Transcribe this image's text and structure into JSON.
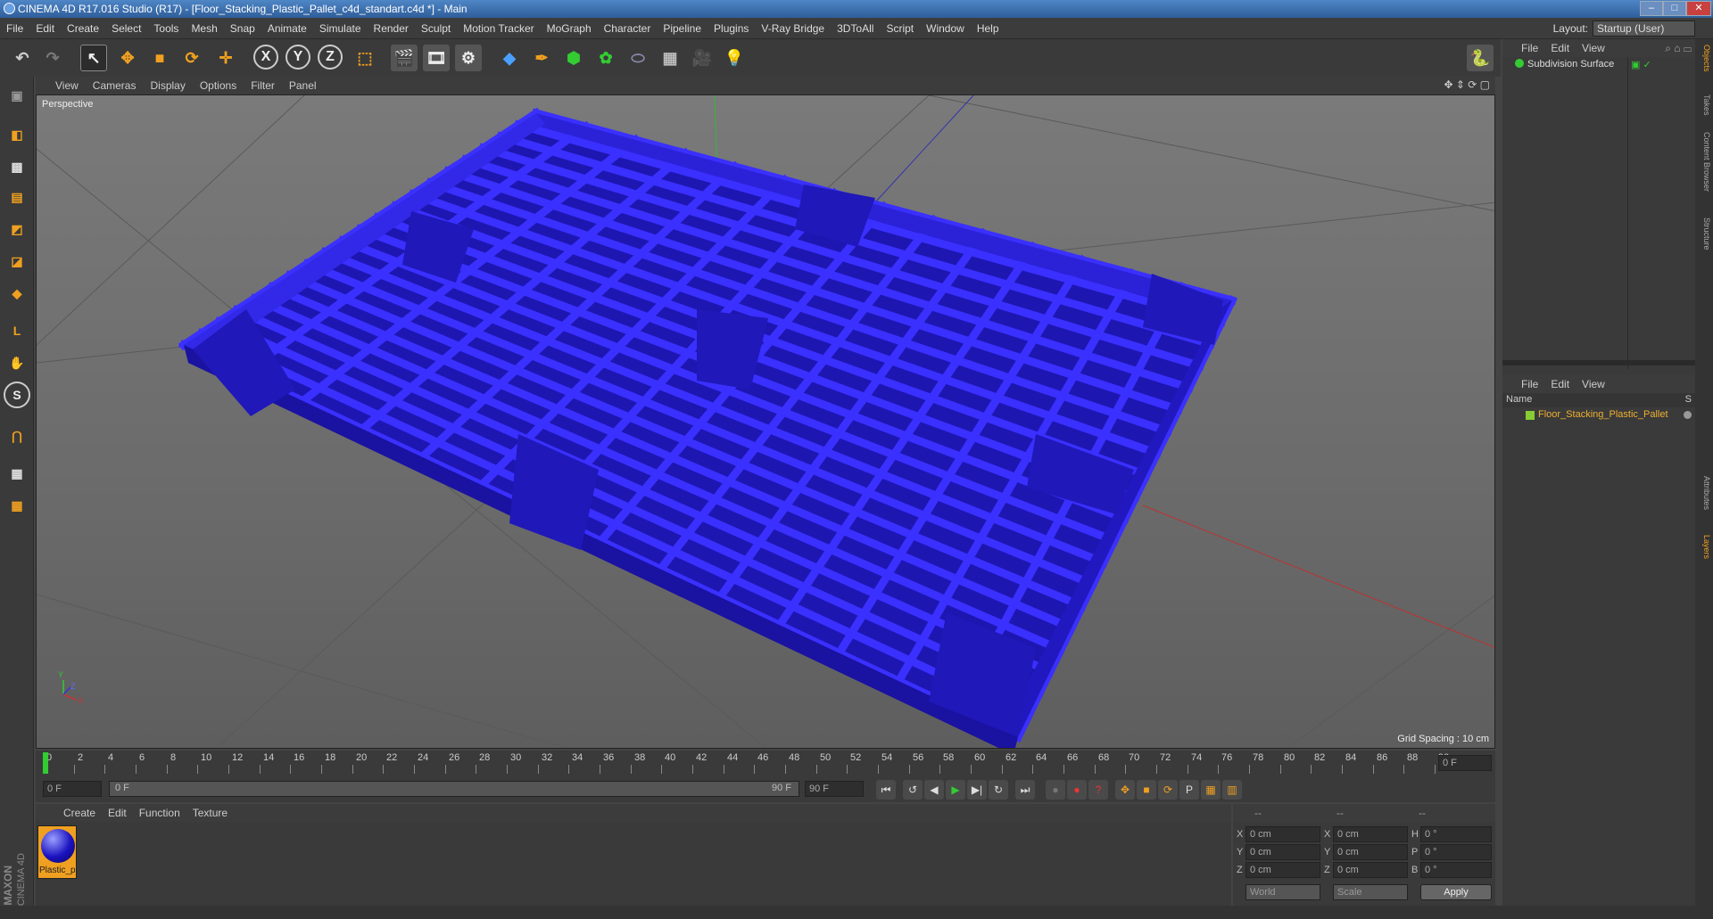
{
  "window": {
    "title": "CINEMA 4D R17.016 Studio (R17) - [Floor_Stacking_Plastic_Pallet_c4d_standart.c4d *] - Main"
  },
  "menu": [
    "File",
    "Edit",
    "Create",
    "Select",
    "Tools",
    "Mesh",
    "Snap",
    "Animate",
    "Simulate",
    "Render",
    "Sculpt",
    "Motion Tracker",
    "MoGraph",
    "Character",
    "Pipeline",
    "Plugins",
    "V-Ray Bridge",
    "3DToAll",
    "Script",
    "Window",
    "Help"
  ],
  "layout": {
    "label": "Layout:",
    "value": "Startup (User)"
  },
  "viewport": {
    "menu": [
      "View",
      "Cameras",
      "Display",
      "Options",
      "Filter",
      "Panel"
    ],
    "label": "Perspective",
    "grid_spacing": "Grid Spacing : 10 cm",
    "axis": {
      "x": "X",
      "y": "Y",
      "z": "Z"
    }
  },
  "timeline": {
    "ticks": [
      "0",
      "2",
      "4",
      "6",
      "8",
      "10",
      "12",
      "14",
      "16",
      "18",
      "20",
      "22",
      "24",
      "26",
      "28",
      "30",
      "32",
      "34",
      "36",
      "38",
      "40",
      "42",
      "44",
      "46",
      "48",
      "50",
      "52",
      "54",
      "56",
      "58",
      "60",
      "62",
      "64",
      "66",
      "68",
      "70",
      "72",
      "74",
      "76",
      "78",
      "80",
      "82",
      "84",
      "86",
      "88",
      "90"
    ],
    "frame_display": "0 F",
    "start": "0 F",
    "range_start": "0 F",
    "range_end": "90 F",
    "end": "90 F"
  },
  "materials": {
    "menu": [
      "Create",
      "Edit",
      "Function",
      "Texture"
    ],
    "items": [
      {
        "label": "Plastic_p"
      }
    ]
  },
  "coords": {
    "header": [
      "--",
      "--",
      "--"
    ],
    "rows": [
      {
        "a": "X",
        "av": "0 cm",
        "b": "X",
        "bv": "0 cm",
        "c": "H",
        "cv": "0 °"
      },
      {
        "a": "Y",
        "av": "0 cm",
        "b": "Y",
        "bv": "0 cm",
        "c": "P",
        "cv": "0 °"
      },
      {
        "a": "Z",
        "av": "0 cm",
        "b": "Z",
        "bv": "0 cm",
        "c": "B",
        "cv": "0 °"
      }
    ],
    "mode1": "World",
    "mode2": "Scale",
    "apply": "Apply"
  },
  "objects": {
    "menu": [
      "File",
      "Edit",
      "View"
    ],
    "items": [
      {
        "label": "Subdivision Surface"
      }
    ]
  },
  "layers": {
    "menu": [
      "File",
      "Edit",
      "View"
    ],
    "col_name": "Name",
    "col_s": "S",
    "items": [
      {
        "label": "Floor_Stacking_Plastic_Pallet"
      }
    ]
  },
  "sidetabs": [
    "Objects",
    "Takes",
    "Content Browser",
    "Structure",
    "Attributes",
    "Layers"
  ],
  "brand": {
    "line1": "MAXON",
    "line2": "CINEMA 4D"
  },
  "colors": {
    "pallet": "#2b22d8",
    "accent": "#f0a020",
    "green_axis": "#3c3"
  }
}
